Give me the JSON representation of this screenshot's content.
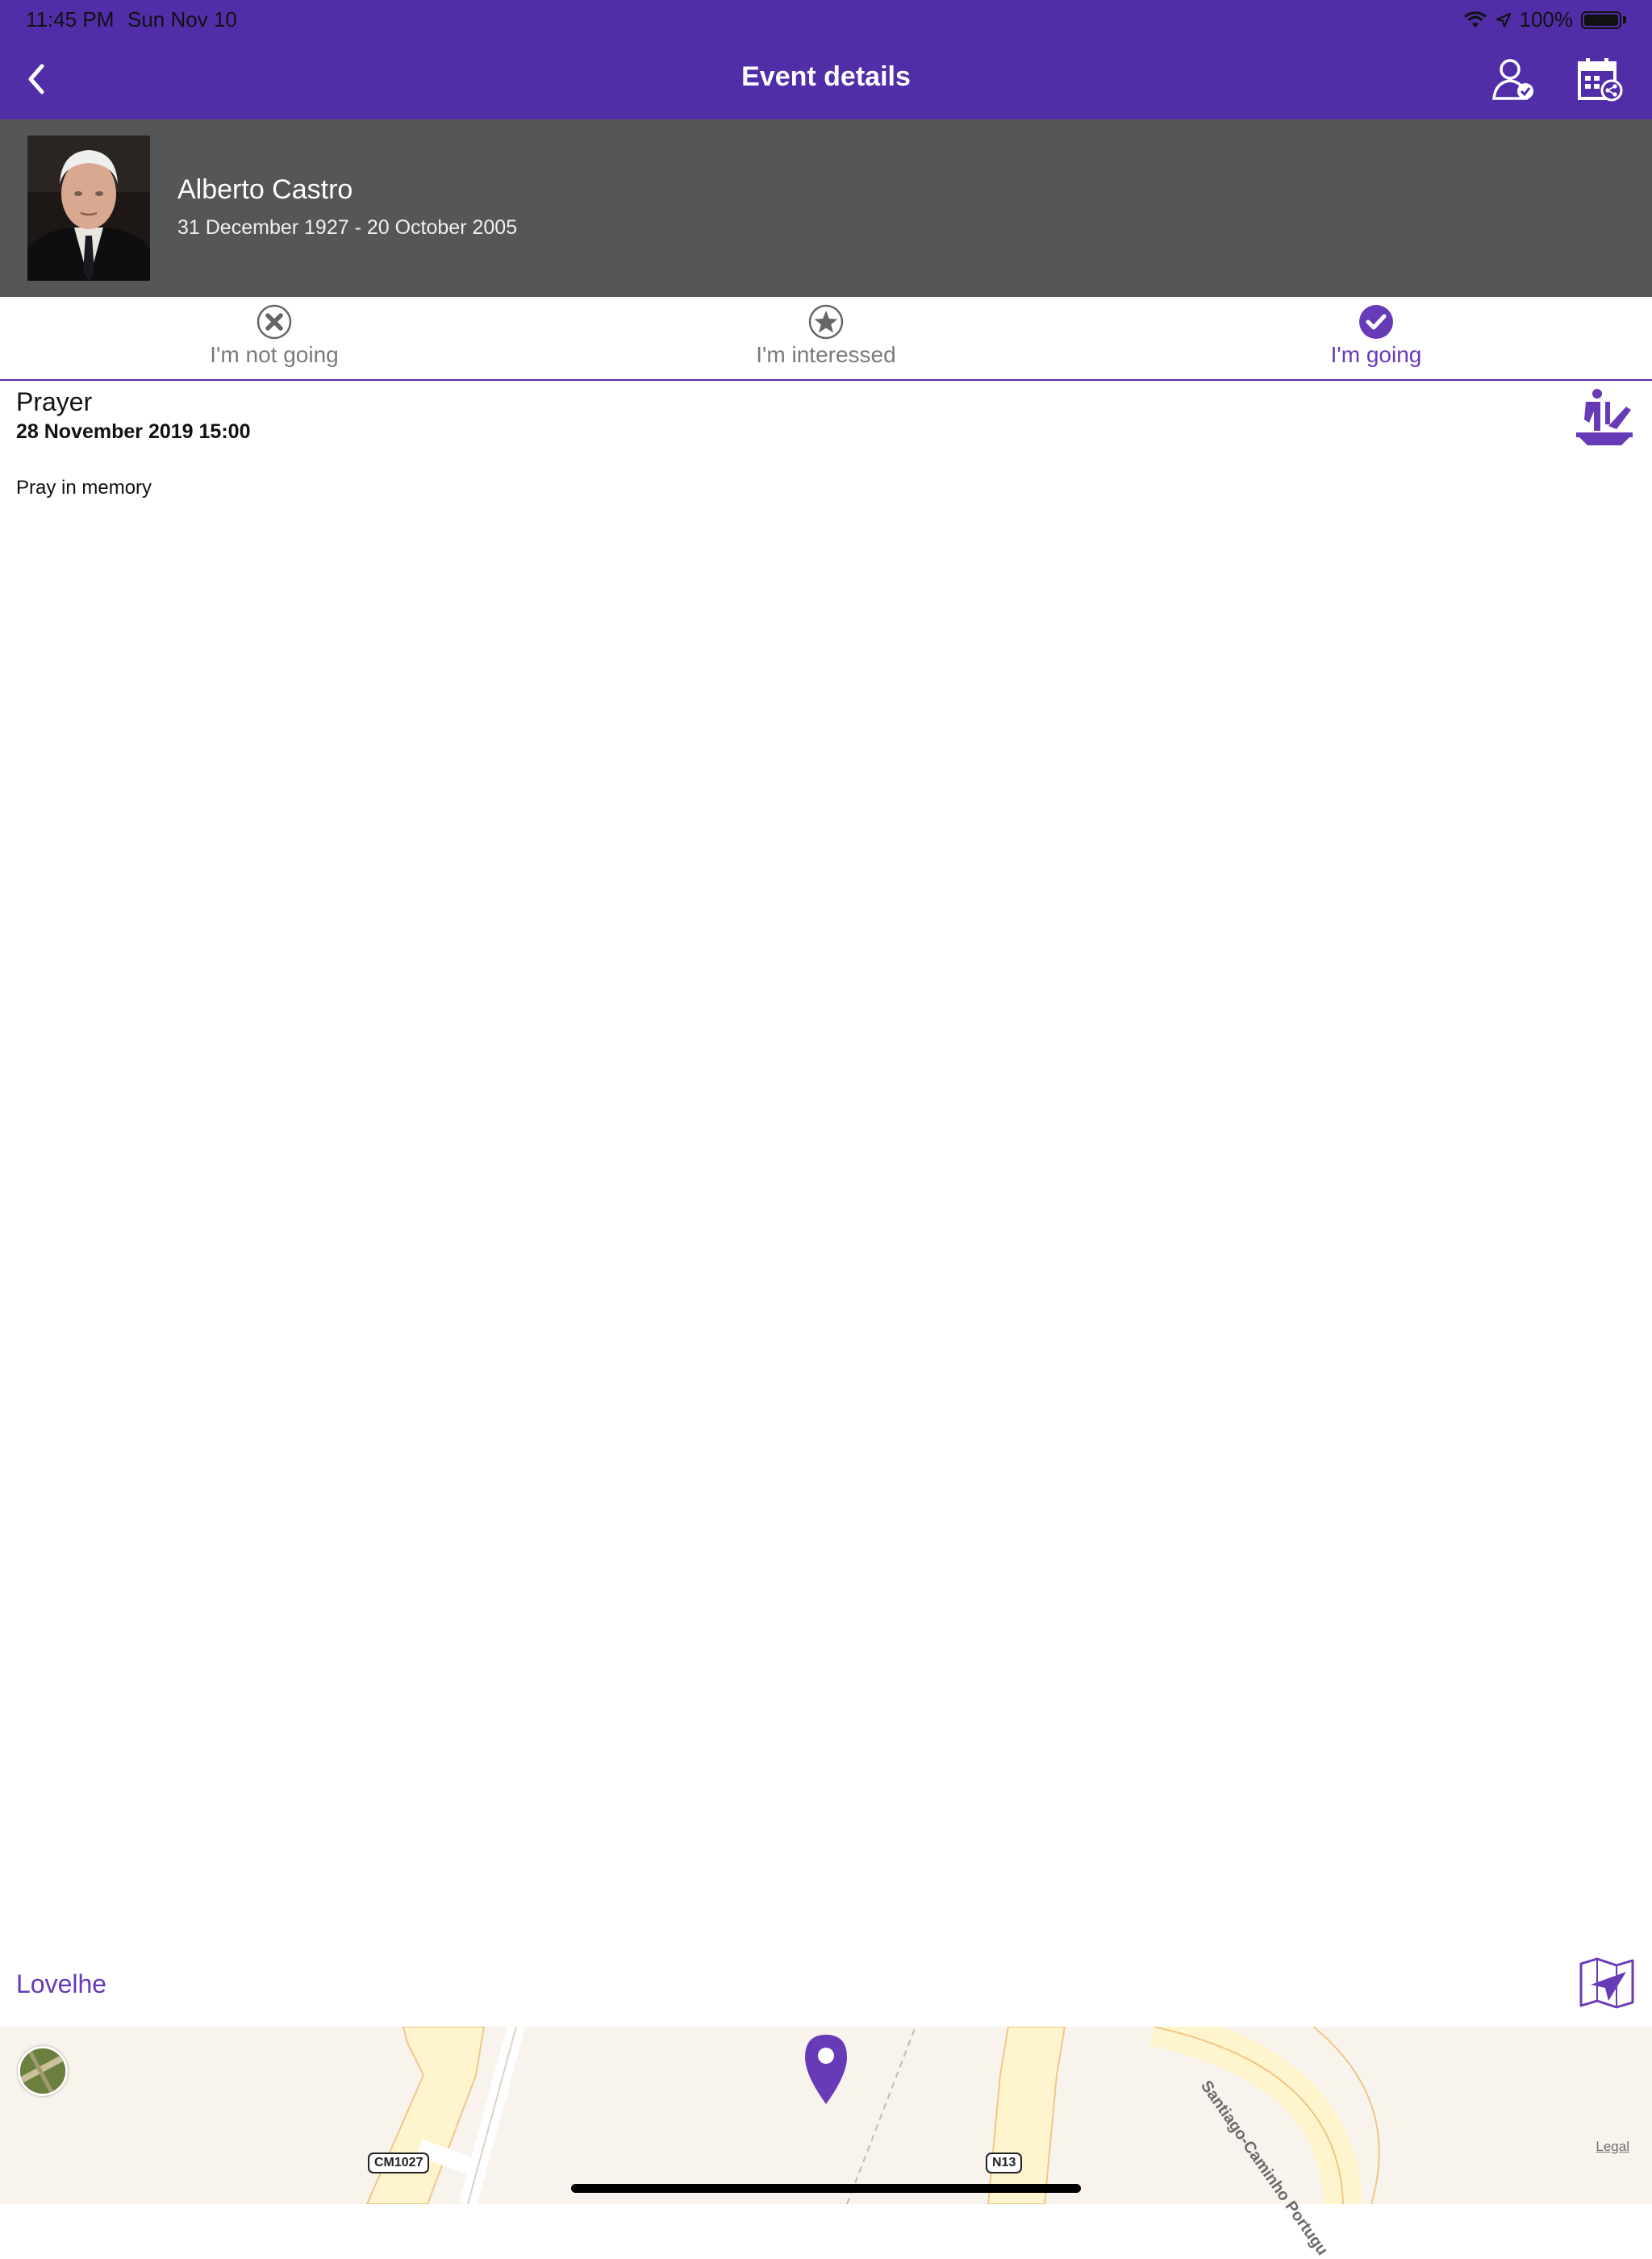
{
  "status_bar": {
    "time": "11:45 PM",
    "date": "Sun Nov 10",
    "battery": "100%"
  },
  "nav": {
    "title": "Event details",
    "accent_color": "#512da8"
  },
  "person": {
    "name": "Alberto Castro",
    "dates": "31 December 1927 - 20 October 2005",
    "header_color": "#565656"
  },
  "rsvp": {
    "options": [
      {
        "label": "I'm not going",
        "icon": "x-circle-icon",
        "selected": false
      },
      {
        "label": "I'm interessed",
        "icon": "star-circle-icon",
        "selected": false
      },
      {
        "label": "I'm going",
        "icon": "check-circle-icon",
        "selected": true
      }
    ]
  },
  "event": {
    "title": "Prayer",
    "datetime": "28 November 2019 15:00",
    "description": "Pray in memory",
    "icon": "praying-person-icon"
  },
  "location": {
    "name": "Lovelhe"
  },
  "map": {
    "road_labels": [
      "CM1027",
      "N13"
    ],
    "scenic_label": "Santiago-Caminho Portugu",
    "legal": "Legal"
  }
}
